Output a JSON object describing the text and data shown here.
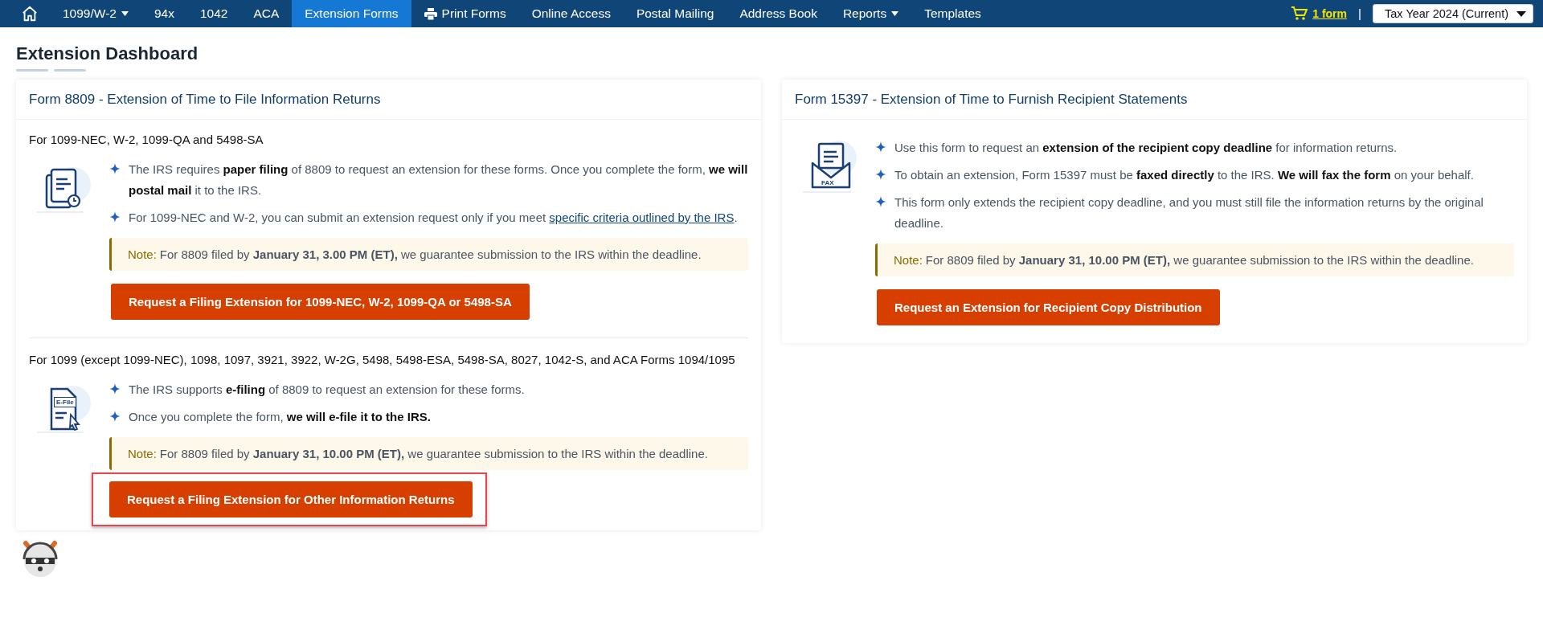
{
  "nav": {
    "items": [
      {
        "kind": "home",
        "selected": false
      },
      {
        "kind": "dropdown",
        "label": "1099/W-2",
        "selected": false
      },
      {
        "kind": "link",
        "label": "94x",
        "selected": false
      },
      {
        "kind": "link",
        "label": "1042",
        "selected": false
      },
      {
        "kind": "link",
        "label": "ACA",
        "selected": false
      },
      {
        "kind": "link",
        "label": "Extension Forms",
        "selected": true
      },
      {
        "kind": "print",
        "label": "Print Forms",
        "selected": false
      },
      {
        "kind": "link",
        "label": "Online Access",
        "selected": false
      },
      {
        "kind": "link",
        "label": "Postal Mailing",
        "selected": false
      },
      {
        "kind": "link",
        "label": "Address Book",
        "selected": false
      },
      {
        "kind": "dropdown",
        "label": "Reports",
        "selected": false
      },
      {
        "kind": "link",
        "label": "Templates",
        "selected": false
      }
    ],
    "cart": "1 form",
    "separator": "|",
    "tax_year": "Tax Year 2024 (Current)"
  },
  "page_title": "Extension Dashboard",
  "cards": [
    {
      "title": "Form 8809 - Extension of Time to File Information Returns",
      "sections": [
        {
          "heading": "For 1099-NEC, W-2, 1099-QA and 5498-SA",
          "kind": "paper",
          "bullets": [
            {
              "text": "The IRS requires **paper filing** of 8809 to request an extension for these forms. Once you complete the form, **we will postal mail** it to the IRS."
            },
            {
              "text": "For 1099-NEC and W-2, you can submit an extension request only if you meet",
              "link": "specific criteria outlined by the IRS",
              "tail": "."
            }
          ],
          "note": {
            "label": "Note:",
            "text": "For 8809 filed by **January 31, 3.00 PM (ET),** we guarantee submission to the IRS within the deadline."
          },
          "button": {
            "label": "Request a Filing Extension for 1099-NEC, W-2, 1099-QA or 5498-SA",
            "highlighted": false
          }
        },
        {
          "heading": "For 1099 (except 1099-NEC), 1098, 1097, 3921, 3922, W-2G, 5498, 5498-ESA, 5498-SA, 8027, 1042-S, and ACA Forms 1094/1095",
          "kind": "efile",
          "icon_label": "E-File",
          "bullets": [
            {
              "text": "The IRS supports **e-filing** of 8809 to request an extension for these forms."
            },
            {
              "text": "Once you complete the form, **we will e-file it to the IRS.**"
            }
          ],
          "note": {
            "label": "Note:",
            "text": "For 8809 filed by **January 31, 10.00 PM (ET),** we guarantee submission to the IRS within the deadline."
          },
          "button": {
            "label": "Request a Filing Extension for Other Information Returns",
            "highlighted": true
          }
        }
      ]
    },
    {
      "title": "Form 15397 - Extension of Time to Furnish Recipient Statements",
      "sections": [
        {
          "kind": "fax",
          "icon_label": "FAX",
          "bullets": [
            {
              "text": "Use this form to request an **extension of the recipient copy deadline** for information returns."
            },
            {
              "text": "To obtain an extension, Form 15397 must be **faxed directly** to the IRS. **We will fax the form** on your behalf."
            },
            {
              "text": "This form only extends the recipient copy deadline, and you must still file the information returns by the original deadline."
            }
          ],
          "note": {
            "label": "Note:",
            "text": "For 8809 filed by **January 31, 10.00 PM (ET),** we guarantee submission to the IRS within the deadline."
          },
          "button": {
            "label": "Request an Extension for Recipient Copy Distribution",
            "highlighted": false
          }
        }
      ]
    }
  ]
}
